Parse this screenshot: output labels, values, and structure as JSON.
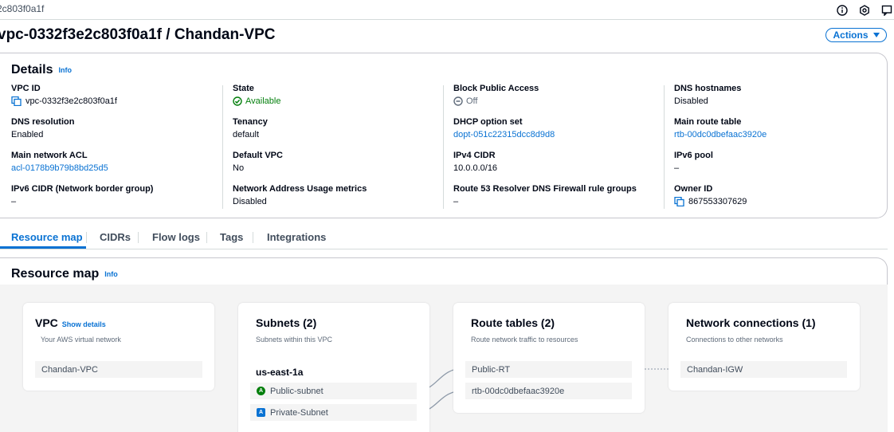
{
  "topbar": {
    "crumb": "2c803f0a1f",
    "icons": [
      "info-icon",
      "settings-icon",
      "feedback-icon"
    ]
  },
  "header": {
    "title": "vpc-0332f3e2c803f0a1f / Chandan-VPC",
    "actions_label": "Actions"
  },
  "details": {
    "title": "Details",
    "info": "Info",
    "columns": [
      [
        {
          "label": "VPC ID",
          "value": "vpc-0332f3e2c803f0a1f"
        },
        {
          "label": "DNS resolution",
          "value": "Enabled"
        },
        {
          "label": "Main network ACL",
          "value": "acl-0178b9b79b8bd25d5"
        },
        {
          "label": "IPv6 CIDR (Network border group)",
          "value": "–"
        }
      ],
      [
        {
          "label": "State",
          "value": "Available"
        },
        {
          "label": "Tenancy",
          "value": "default"
        },
        {
          "label": "Default VPC",
          "value": "No"
        },
        {
          "label": "Network Address Usage metrics",
          "value": "Disabled"
        }
      ],
      [
        {
          "label": "Block Public Access",
          "value": "Off"
        },
        {
          "label": "DHCP option set",
          "value": "dopt-051c22315dcc8d9d8"
        },
        {
          "label": "IPv4 CIDR",
          "value": "10.0.0.0/16"
        },
        {
          "label": "Route 53 Resolver DNS Firewall rule groups",
          "value": "–"
        }
      ],
      [
        {
          "label": "DNS hostnames",
          "value": "Disabled"
        },
        {
          "label": "Main route table",
          "value": "rtb-00dc0dbefaac3920e"
        },
        {
          "label": "IPv6 pool",
          "value": "–"
        },
        {
          "label": "Owner ID",
          "value": "867553307629"
        }
      ]
    ]
  },
  "tabs": [
    {
      "label": "Resource map",
      "active": true
    },
    {
      "label": "CIDRs"
    },
    {
      "label": "Flow logs"
    },
    {
      "label": "Tags"
    },
    {
      "label": "Integrations"
    }
  ],
  "resource_map": {
    "title": "Resource map",
    "info": "Info",
    "vpc": {
      "title": "VPC",
      "show_details": "Show details",
      "subtitle": "Your AWS virtual network",
      "item": "Chandan-VPC"
    },
    "subnets": {
      "title": "Subnets (2)",
      "subtitle": "Subnets within this VPC",
      "az": "us-east-1a",
      "items": [
        {
          "badge": "A",
          "name": "Public-subnet"
        },
        {
          "badge": "A",
          "name": "Private-Subnet"
        }
      ]
    },
    "route_tables": {
      "title": "Route tables (2)",
      "subtitle": "Route network traffic to resources",
      "items": [
        "Public-RT",
        "rtb-00dc0dbefaac3920e"
      ]
    },
    "network_connections": {
      "title": "Network connections (1)",
      "subtitle": "Connections to other networks",
      "items": [
        "Chandan-IGW"
      ]
    }
  },
  "colors": {
    "accent": "#0972d3",
    "success": "#037f0c",
    "border": "#c6c6cd"
  }
}
